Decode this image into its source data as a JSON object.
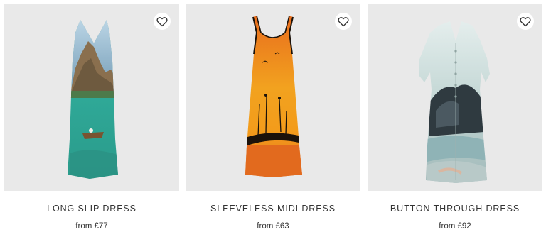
{
  "products": [
    {
      "name": "LONG SLIP DRESS",
      "price": "from £77",
      "favorite_icon": "heart-outline-icon"
    },
    {
      "name": "SLEEVELESS MIDI DRESS",
      "price": "from £63",
      "favorite_icon": "heart-outline-icon"
    },
    {
      "name": "BUTTON THROUGH DRESS",
      "price": "from £92",
      "favorite_icon": "heart-outline-icon"
    }
  ],
  "colors": {
    "image_background": "#e9e9e9",
    "text": "#333333",
    "lake_teal": "#2f9c93",
    "sunset_orange": "#ef8a1e",
    "mist_blue": "#cfdedc"
  }
}
